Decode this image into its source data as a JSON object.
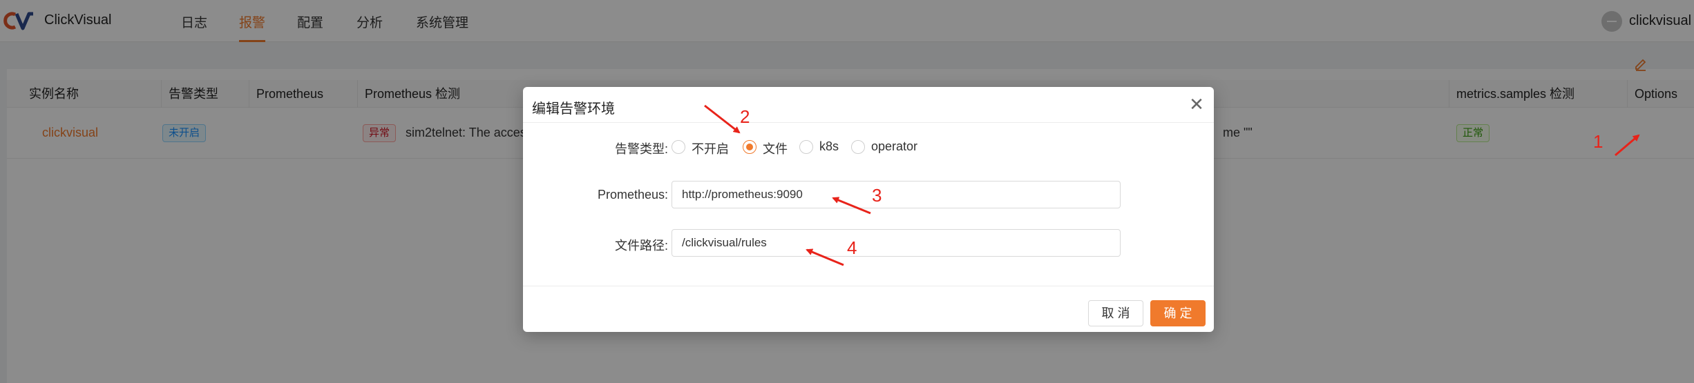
{
  "app": {
    "title": "ClickVisual"
  },
  "nav": [
    {
      "label": "日志",
      "active": false
    },
    {
      "label": "报警",
      "active": true
    },
    {
      "label": "配置",
      "active": false
    },
    {
      "label": "分析",
      "active": false
    },
    {
      "label": "系统管理",
      "active": false
    }
  ],
  "user": {
    "name": "clickvisual"
  },
  "table": {
    "headers": [
      "实例名称",
      "告警类型",
      "Prometheus",
      "Prometheus 检测",
      "metrics.samples 检测",
      "Options"
    ],
    "rows": [
      {
        "name": "clickvisual",
        "alert_type_tag": "未开启",
        "prometheus_status_tag": "异常",
        "prometheus_message": "sim2telnet: The acces",
        "cut_text": "me \"\"",
        "metrics_status_tag": "正常"
      }
    ]
  },
  "modal": {
    "title": "编辑告警环境",
    "alert_type_label": "告警类型:",
    "radio_options": [
      {
        "label": "不开启",
        "checked": false
      },
      {
        "label": "文件",
        "checked": true
      },
      {
        "label": "k8s",
        "checked": false
      },
      {
        "label": "operator",
        "checked": false
      }
    ],
    "prometheus_label": "Prometheus:",
    "prometheus_value": "http://prometheus:9090",
    "file_path_label": "文件路径:",
    "file_path_value": "/clickvisual/rules",
    "cancel_label": "取 消",
    "ok_label": "确 定"
  },
  "annotations": [
    "1",
    "2",
    "3",
    "4"
  ],
  "colors": {
    "accent": "#f07a2c",
    "annotation": "#e8231a"
  }
}
